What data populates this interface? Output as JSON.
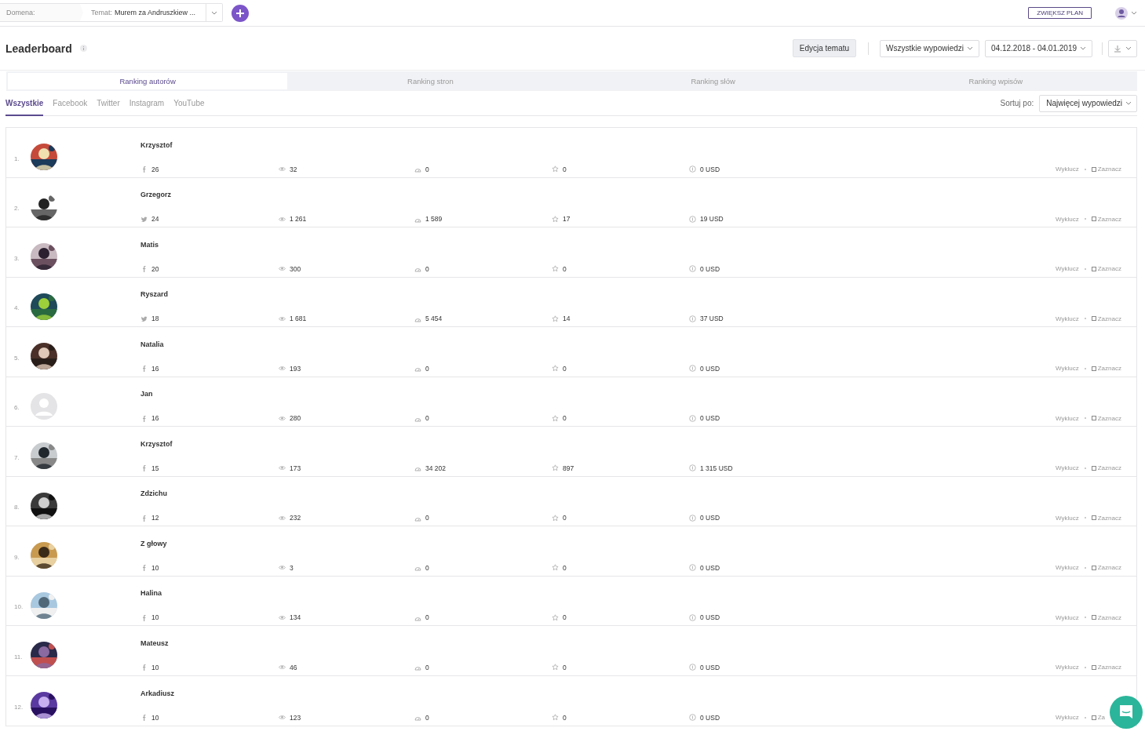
{
  "topbar": {
    "domain_label": "Domena:",
    "topic_label": "Temat:",
    "topic_value": "Murem za Andruszkiew ...",
    "upgrade_button": "ZWIĘKSZ PLAN"
  },
  "header": {
    "title": "Leaderboard",
    "edit_button": "Edycja tematu",
    "filter_dropdown": "Wszystkie wypowiedzi",
    "date_range": "04.12.2018 - 04.01.2019"
  },
  "tabs": [
    {
      "label": "Ranking autorów",
      "selected": true
    },
    {
      "label": "Ranking stron",
      "selected": false
    },
    {
      "label": "Ranking słów",
      "selected": false
    },
    {
      "label": "Ranking wpisów",
      "selected": false
    }
  ],
  "filters": [
    {
      "label": "Wszystkie",
      "selected": true
    },
    {
      "label": "Facebook",
      "selected": false
    },
    {
      "label": "Twitter",
      "selected": false
    },
    {
      "label": "Instagram",
      "selected": false
    },
    {
      "label": "YouTube",
      "selected": false
    }
  ],
  "sort": {
    "label": "Sortuj po:",
    "value": "Najwięcej wypowiedzi"
  },
  "rows": [
    {
      "rank": "1.",
      "name": "Krzysztof",
      "posts": {
        "kind": "facebook",
        "count": "26"
      },
      "views": "32",
      "reach": "0",
      "favorites": "0",
      "value": "0 USD",
      "exclude": "Wyklucz",
      "select": "Zaznacz",
      "checked": false
    },
    {
      "rank": "2.",
      "name": "Grzegorz",
      "posts": {
        "kind": "twitter",
        "count": "24"
      },
      "views": "1 261",
      "reach": "1 589",
      "favorites": "17",
      "value": "19 USD",
      "exclude": "Wyklucz",
      "select": "Zaznacz",
      "checked": false
    },
    {
      "rank": "3.",
      "name": "Matis",
      "posts": {
        "kind": "facebook",
        "count": "20"
      },
      "views": "300",
      "reach": "0",
      "favorites": "0",
      "value": "0 USD",
      "exclude": "Wyklucz",
      "select": "Zaznacz",
      "checked": false
    },
    {
      "rank": "4.",
      "name": "Ryszard",
      "posts": {
        "kind": "twitter",
        "count": "18"
      },
      "views": "1 681",
      "reach": "5 454",
      "favorites": "14",
      "value": "37 USD",
      "exclude": "Wyklucz",
      "select": "Zaznacz",
      "checked": false
    },
    {
      "rank": "5.",
      "name": "Natalia",
      "posts": {
        "kind": "facebook",
        "count": "16"
      },
      "views": "193",
      "reach": "0",
      "favorites": "0",
      "value": "0 USD",
      "exclude": "Wyklucz",
      "select": "Zaznacz",
      "checked": false
    },
    {
      "rank": "6.",
      "avatar": {
        "kind": "placeholder"
      },
      "name": "Jan",
      "posts": {
        "kind": "facebook",
        "count": "16"
      },
      "views": "280",
      "reach": "0",
      "favorites": "0",
      "value": "0 USD",
      "exclude": "Wyklucz",
      "select": "Zaznacz",
      "checked": false
    },
    {
      "rank": "7.",
      "name": "Krzysztof",
      "posts": {
        "kind": "facebook",
        "count": "15"
      },
      "views": "173",
      "reach": "34 202",
      "favorites": "897",
      "value": "1 315 USD",
      "exclude": "Wyklucz",
      "select": "Zaznacz",
      "checked": false
    },
    {
      "rank": "8.",
      "name": "Zdzichu",
      "posts": {
        "kind": "facebook",
        "count": "12"
      },
      "views": "232",
      "reach": "0",
      "favorites": "0",
      "value": "0 USD",
      "exclude": "Wyklucz",
      "select": "Zaznacz",
      "checked": false
    },
    {
      "rank": "9.",
      "name": "Z głowy",
      "posts": {
        "kind": "facebook",
        "count": "10"
      },
      "views": "3",
      "reach": "0",
      "favorites": "0",
      "value": "0 USD",
      "exclude": "Wyklucz",
      "select": "Zaznacz",
      "checked": false
    },
    {
      "rank": "10.",
      "name": "Halina",
      "posts": {
        "kind": "facebook",
        "count": "10"
      },
      "views": "134",
      "reach": "0",
      "favorites": "0",
      "value": "0 USD",
      "exclude": "Wyklucz",
      "select": "Zaznacz",
      "checked": false
    },
    {
      "rank": "11.",
      "name": "Mateusz",
      "posts": {
        "kind": "facebook",
        "count": "10"
      },
      "views": "46",
      "reach": "0",
      "favorites": "0",
      "value": "0 USD",
      "exclude": "Wyklucz",
      "select": "Zaznacz",
      "checked": false
    },
    {
      "rank": "12.",
      "name": "Arkadiusz",
      "posts": {
        "kind": "facebook",
        "count": "10"
      },
      "views": "123",
      "reach": "0",
      "favorites": "0",
      "value": "0 USD",
      "exclude": "Wyklucz",
      "select": "Za",
      "checked": false
    }
  ]
}
